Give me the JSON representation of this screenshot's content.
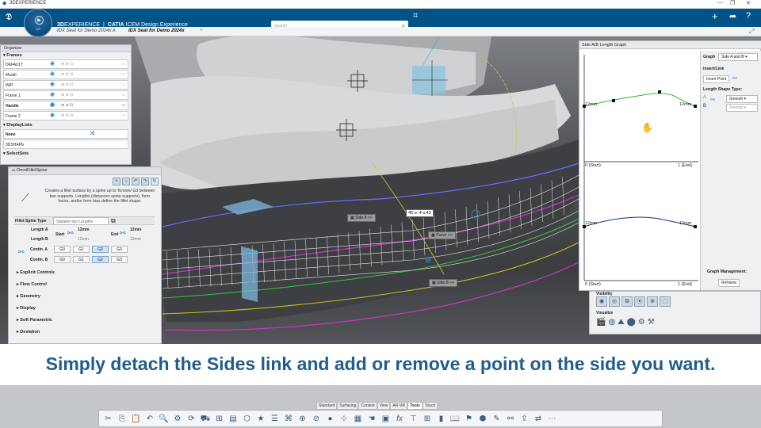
{
  "window": {
    "title": "3DEXPERIENCE"
  },
  "brand": {
    "prefix": "3D",
    "name": "EXPERIENCE",
    "app": "CATIA",
    "context": "ICEM Design Experience"
  },
  "compass": {
    "version": "V,R"
  },
  "search": {
    "placeholder": "Search"
  },
  "tabs": [
    {
      "label": "IDX Seat for Demo 2024x A",
      "active": false
    },
    {
      "label": "IDX Seat for Demo 2024x",
      "active": true
    }
  ],
  "organize": {
    "title": "Organize",
    "frames_label": "Frames",
    "frames": [
      "DEFAULT",
      "Model",
      "WIP",
      "Frame 1",
      "Handle",
      "Frame 2"
    ],
    "displaylists_label": "DisplayLists",
    "displaylists": [
      "None",
      "3DSHAPE"
    ],
    "selectsets_label": "SelectSets"
  },
  "omni": {
    "title": "OmniFilletSpine",
    "description": "Creates a fillet surface by a spine up to Torsion/ G3 between two supports. Lengths (distances spine-supports), form factor, and/or form bias define the fillet shape.",
    "fillet_spine_type_label": "Fillet Spine Type",
    "fillet_spine_type_value": "Variable two Lengths",
    "length_a": "Length A",
    "length_b": "Length B",
    "start": "Start",
    "end": "End",
    "start_a": "12mm",
    "start_b": "12mm",
    "end_a": "12mm",
    "end_b": "12mm",
    "contin_a": "Contin. A",
    "contin_b": "Contin. B",
    "g_options": [
      "G0",
      "G1",
      "G2",
      "G3"
    ],
    "sections": [
      "Explicit Controls",
      "Flow Control",
      "Geometry",
      "Display",
      "Soft Parametric",
      "Deviation"
    ]
  },
  "viewport": {
    "labels": {
      "side_a": "Side A >>",
      "side_b": "Side B >>",
      "curve": "Curve >>",
      "readout": "46 o: 4 s:43"
    }
  },
  "graph": {
    "title": "Side A/B Length Graph",
    "top_left": "12mm",
    "top_right": "12mm",
    "bottom_left": "12mm",
    "bottom_right": "12mm",
    "axis_start": "0 (Start)",
    "axis_end": "1 (End)",
    "graph_label": "Graph",
    "graph_value": "Side A and B",
    "insert_link": "Insert/Link",
    "insert_point": "Insert Point",
    "length_shape_type": "Length Shape Type:",
    "shape_a": "Smooth",
    "shape_b": "Smooth",
    "graph_management": "Graph Management:",
    "reframe": "Reframe"
  },
  "vis": {
    "visibility": "Visibility",
    "visualize": "Visualize"
  },
  "caption": "Simply detach the Sides link and add or remove a point on the side you want.",
  "action_tabs": [
    "Standard",
    "Surfacing",
    "Context",
    "View",
    "AR-VR",
    "Tools",
    "Touch"
  ],
  "active_action_tab": "Tools"
}
